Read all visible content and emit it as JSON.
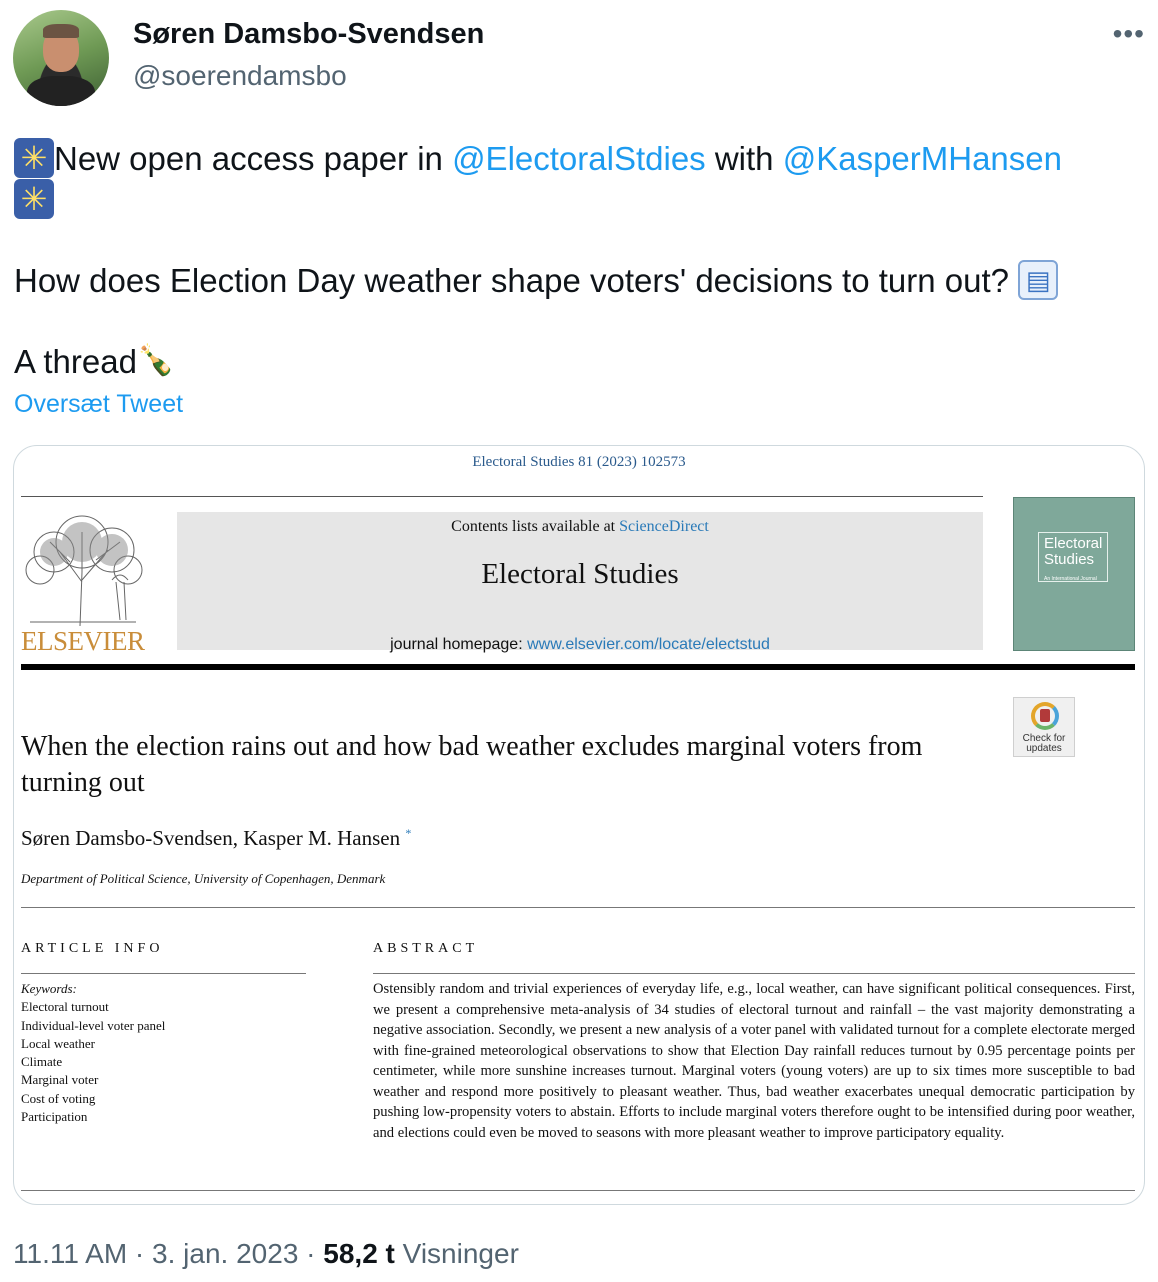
{
  "author": {
    "name": "Søren Damsbo-Svendsen",
    "handle": "@soerendamsbo",
    "more_label": "•••"
  },
  "tweet": {
    "line1_prefix": "New open access paper in ",
    "mention1": "@ElectoralStdies",
    "line1_mid": " with ",
    "mention2": "@KasperMHansen",
    "line2": "How does Election Day weather shape voters' decisions to turn out? ",
    "line3": "A thread",
    "translate_label": "Oversæt Tweet"
  },
  "paper": {
    "journal_ref": "Electoral Studies 81 (2023) 102573",
    "publisher": "ELSEVIER",
    "contents_prefix": "Contents lists available at ",
    "contents_link": "ScienceDirect",
    "journal_title": "Electoral Studies",
    "homepage_prefix": "journal homepage: ",
    "homepage_link": "www.elsevier.com/locate/electstud",
    "cover_title": "Electoral Studies",
    "cover_subtitle": "An International Journal",
    "check_label": "Check for updates",
    "title": "When the election rains out and how bad weather excludes marginal voters from turning out",
    "authors": "Søren Damsbo-Svendsen, Kasper M. Hansen",
    "author_mark": "*",
    "affiliation": "Department of Political Science, University of Copenhagen, Denmark",
    "article_info_heading": "ARTICLE INFO",
    "keywords_label": "Keywords:",
    "keywords": [
      "Electoral turnout",
      "Individual-level voter panel",
      "Local weather",
      "Climate",
      "Marginal voter",
      "Cost of voting",
      "Participation"
    ],
    "abstract_heading": "ABSTRACT",
    "abstract": "Ostensibly random and trivial experiences of everyday life, e.g., local weather, can have significant political consequences. First, we present a comprehensive meta-analysis of 34 studies of electoral turnout and rainfall – the vast majority demonstrating a negative association. Secondly, we present a new analysis of a voter panel with validated turnout for a complete electorate merged with fine-grained meteorological observations to show that Election Day rainfall reduces turnout by 0.95 percentage points per centimeter, while more sunshine increases turnout. Marginal voters (young voters) are up to six times more susceptible to bad weather and respond more positively to pleasant weather. Thus, bad weather exacerbates unequal democratic participation by pushing low-propensity voters to abstain. Efforts to include marginal voters therefore ought to be intensified during poor weather, and elections could even be moved to seasons with more pleasant weather to improve participatory equality."
  },
  "meta": {
    "time": "11.11 AM",
    "sep": " · ",
    "date": "3. jan. 2023",
    "views_count": "58,2 t",
    "views_label": " Visninger"
  },
  "colors": {
    "link_blue": "#1d9bf0",
    "muted_gray": "#536471"
  }
}
